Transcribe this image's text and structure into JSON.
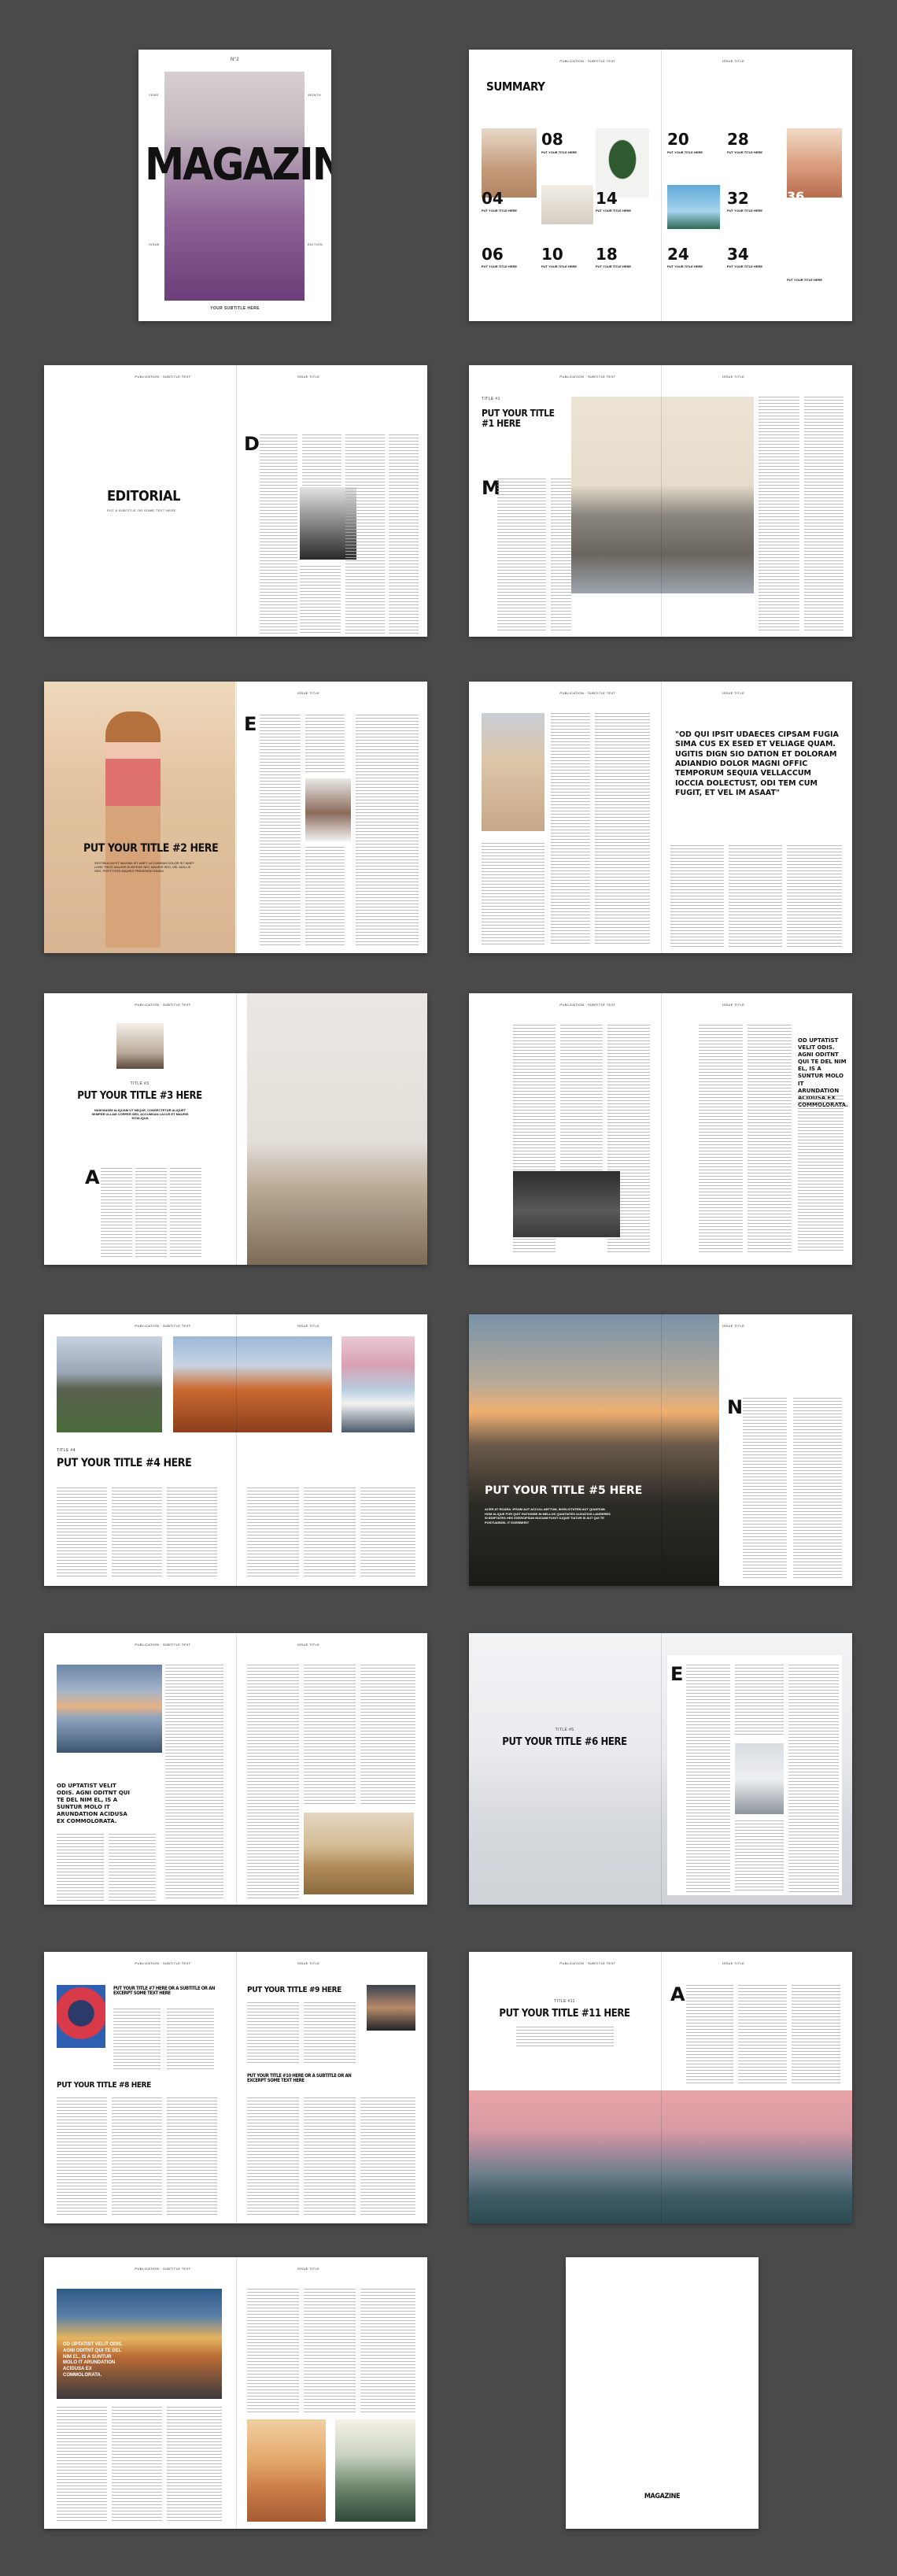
{
  "cover": {
    "issue": "N°2",
    "side_left": "YEAR",
    "side_right": "MONTH",
    "side_left2": "ISSUE",
    "side_right2": "EDITION",
    "title": "MAGAZINE",
    "subtitle": "YOUR SUBTITLE HERE"
  },
  "header": {
    "left": "PUBLICATION · SUBTITLE TEXT",
    "right": "ISSUE TITLE"
  },
  "summary": {
    "title": "SUMMARY",
    "items": [
      {
        "n": "08",
        "t": "PUT YOUR TITLE HERE"
      },
      {
        "n": "04",
        "t": "PUT YOUR TITLE HERE"
      },
      {
        "n": "14",
        "t": "PUT YOUR TITLE HERE"
      },
      {
        "n": "06",
        "t": "PUT YOUR TITLE HERE"
      },
      {
        "n": "10",
        "t": "PUT YOUR TITLE HERE"
      },
      {
        "n": "18",
        "t": "PUT YOUR TITLE HERE"
      },
      {
        "n": "20",
        "t": "PUT YOUR TITLE HERE"
      },
      {
        "n": "28",
        "t": "PUT YOUR TITLE HERE"
      },
      {
        "n": "32",
        "t": "PUT YOUR TITLE HERE"
      },
      {
        "n": "24",
        "t": "PUT YOUR TITLE HERE"
      },
      {
        "n": "34",
        "t": "PUT YOUR TITLE HERE"
      },
      {
        "n": "36",
        "t": "PUT YOUR TITLE HERE"
      }
    ]
  },
  "editorial": {
    "title": "EDITORIAL",
    "subtitle": "PUT A SUBTITLE OR SOME TEXT HERE",
    "dropcap": "D"
  },
  "s1": {
    "kicker": "TITLE #1",
    "title": "PUT YOUR TITLE #1 HERE",
    "dropcap": "M"
  },
  "s2": {
    "title": "PUT YOUR TITLE #2 HERE",
    "lead": "VESTIBULUM ET MAXIMA SIT AMET, ACCUMSAN DOLOR SIT AMET LORE TRICE MAURIS ELEIFEND NEC MAURIS SED, VEL MOLLIS SED, PORTTITOR MAURIS PRESENTATIONEM",
    "dropcap": "E"
  },
  "s3": {
    "quote": "\"OD QUI IPSIT UDAECES CIPSAM FUGIA SIMA CUS EX ESED ET VELIAGE QUAM. UGITIS DIGN SIO DATION ET DOLORAM ADIANDIO DOLOR MAGNI OFFIC TEMPORUM SEQUIA VELLACCUM IOCCIA DOLECTUST, ODI TEM CUM FUGIT, ET VEL IM ASAAT\""
  },
  "s4": {
    "kicker": "TITLE #3",
    "title": "PUT YOUR TITLE #3 HERE",
    "lead": "NAM MAXIM ALIQUAM UT NEQUE, CONSECTETUR ALIQUET SEMPER ULLAM CORPER SED, ACCUMSAN LACUS ET MAURIS SITALIQUA",
    "dropcap": "A"
  },
  "s5": {
    "quote": "OD UPTATIST VELIT ODIS. AGNI ODITNT QUI TE DEL NIM EL, IS A SUNTUR MOLO IT ARUNDATION ACIDUSA EX COMMOLORATA."
  },
  "s6": {
    "kicker": "TITLE #4",
    "title": "PUT YOUR TITLE #4 HERE"
  },
  "s7": {
    "title": "PUT YOUR TITLE #5 HERE",
    "lead": "ACER AT ROARA. IPSUM AUT ACCULLABTTUM, INVELICTATEM AUT QUIATIUM. HOM ALIQUE POR QUIT RATIONSE IN MELLOS QUIATIATES AUGATIUS LANGERES SI EDIPTATES HES EXERCIPSUN NUCIAM FUGIT ILIQUE TIATUR SI AUT QUI TE POSTUARDEL IT EXERBERIT",
    "dropcap": "N"
  },
  "s8": {
    "quote": "OD UPTATIST VELIT ODIS. AGNI ODITNT QUI TE DEL NIM EL, IS A SUNTUR MOLO IT ARUNDATION ACIDUSA EX COMMOLORATA."
  },
  "s9": {
    "kicker": "TITLE #6",
    "title": "PUT YOUR TITLE #6 HERE",
    "dropcap": "E"
  },
  "s10": {
    "title_a": "PUT YOUR TITLE #7 HERE OR A SUBTITLE OR AN EXCERPT SOME TEXT HERE",
    "title_b": "PUT YOUR TITLE #8 HERE",
    "title_c": "PUT YOUR TITLE #9 HERE",
    "title_d": "PUT YOUR TITLE #10 HERE OR A SUBTITLE OR AN EXCERPT SOME TEXT HERE"
  },
  "s11": {
    "kicker": "TITLE #11",
    "title": "PUT YOUR TITLE #11 HERE",
    "dropcap": "A"
  },
  "s12": {
    "caption": "OD UPTATIST VELIT ODIS. AGNI ODITNT QUI TE DEL NIM EL, IS A SUNTUR MOLO IT ARUNDATION ACIDUSA EX COMMOLORATA."
  },
  "back": {
    "title": "MAGAZINE"
  }
}
